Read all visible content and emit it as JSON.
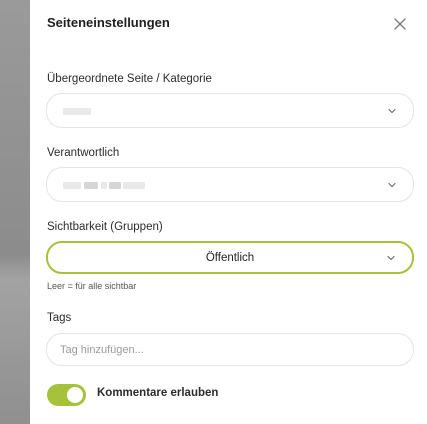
{
  "dialog": {
    "title": "Seiteneinstellungen",
    "close_icon": "close-icon"
  },
  "parent": {
    "label": "Übergeordnete Seite / Kategorie",
    "value": ""
  },
  "owner": {
    "label": "Verantwortlich",
    "value": ""
  },
  "visibility": {
    "label": "Sichtbarkeit (Gruppen)",
    "value": "Öffentlich",
    "hint": "Leer = für alle sichtbar"
  },
  "tags": {
    "label": "Tags",
    "value": "",
    "placeholder": "Tag hinzufügen..."
  },
  "comments": {
    "label": "Kommentare erlauben",
    "enabled": true
  },
  "colors": {
    "accent": "#a6c23a",
    "border": "#e4e4e4",
    "text": "#2b2b2b"
  }
}
